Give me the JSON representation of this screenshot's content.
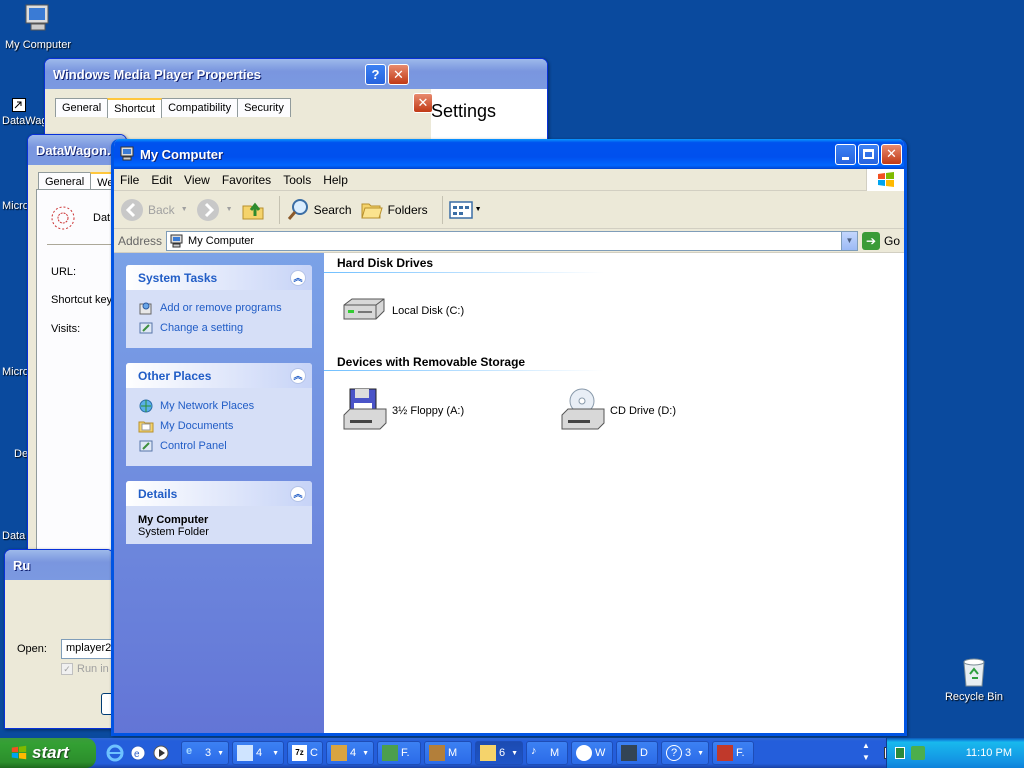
{
  "desktop": {
    "icons": [
      {
        "label": "My Computer"
      },
      {
        "label": "DataWag"
      },
      {
        "label": "Micro C"
      },
      {
        "label": "Micro Ba"
      },
      {
        "label": "De"
      },
      {
        "label": "Data"
      },
      {
        "label": "Recycle Bin"
      }
    ]
  },
  "wmp_properties": {
    "title": "Windows Media Player Properties",
    "tabs": [
      "General",
      "Shortcut",
      "Compatibility",
      "Security"
    ],
    "behind_text": "Settings"
  },
  "datawagon_properties": {
    "title": "DataWagon.c",
    "tabs": [
      "General",
      "We"
    ],
    "app_name": "Dat",
    "fields": [
      "URL:",
      "Shortcut key",
      "Visits:"
    ]
  },
  "run_dialog": {
    "title": "Ru",
    "open_label": "Open:",
    "open_value": "mplayer2",
    "checkbox_label": "Run in"
  },
  "my_computer": {
    "title": "My Computer",
    "menu": [
      "File",
      "Edit",
      "View",
      "Favorites",
      "Tools",
      "Help"
    ],
    "toolbar": {
      "back": "Back",
      "search": "Search",
      "folders": "Folders"
    },
    "address": {
      "label": "Address",
      "value": "My Computer",
      "go": "Go"
    },
    "system_tasks": {
      "title": "System Tasks",
      "links": [
        "Add or remove programs",
        "Change a setting"
      ]
    },
    "other_places": {
      "title": "Other Places",
      "links": [
        "My Network Places",
        "My Documents",
        "Control Panel"
      ]
    },
    "details": {
      "title": "Details",
      "name": "My Computer",
      "type": "System Folder"
    },
    "groups": [
      {
        "title": "Hard Disk Drives",
        "items": [
          "Local Disk (C:)"
        ]
      },
      {
        "title": "Devices with Removable Storage",
        "items": [
          "3½ Floppy (A:)",
          "CD Drive (D:)"
        ]
      }
    ]
  },
  "taskbar": {
    "start": "start",
    "buttons": [
      {
        "label": "3",
        "icon": "ie-icon"
      },
      {
        "label": "4",
        "icon": "notepad-icon"
      },
      {
        "label": "C",
        "icon": "7zip-icon"
      },
      {
        "label": "4",
        "icon": "app-icon"
      },
      {
        "label": "F.",
        "icon": "frontpage-icon"
      },
      {
        "label": "M",
        "icon": "mmc-icon"
      },
      {
        "label": "6",
        "icon": "folder-icon"
      },
      {
        "label": "M",
        "icon": "music-icon"
      },
      {
        "label": "W",
        "icon": "wmp-icon"
      },
      {
        "label": "D",
        "icon": "datawagon-icon"
      },
      {
        "label": "3",
        "icon": "help-icon"
      },
      {
        "label": "F.",
        "icon": "app2-icon"
      }
    ],
    "clock": "11:10 PM"
  }
}
